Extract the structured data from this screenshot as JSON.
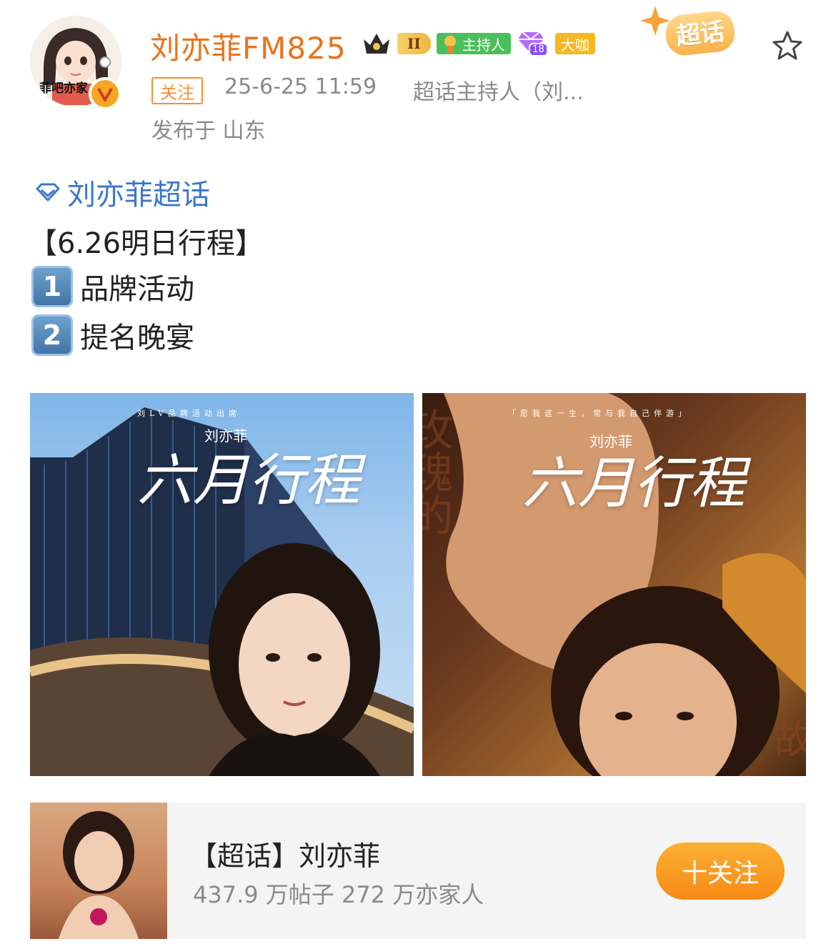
{
  "user": {
    "avatar_text": "菲吧亦家",
    "name": "刘亦菲FM825",
    "badges": {
      "level": "II",
      "host": "主持人",
      "gem_level": "18",
      "daka": "大咖"
    },
    "chaohua_sticker": "超话"
  },
  "meta": {
    "follow": "关注",
    "time": "25-6-25 11:59",
    "source": "超话主持人（刘...",
    "location": "发布于 山东"
  },
  "content": {
    "topic": "刘亦菲超话",
    "headline": "【6.26明日行程】",
    "items": [
      {
        "num": "1",
        "text": "品牌活动"
      },
      {
        "num": "2",
        "text": "提名晚宴"
      }
    ]
  },
  "images": [
    {
      "name": "刘亦菲",
      "title": "六月行程",
      "caption": "刘LV品牌活动出席"
    },
    {
      "name": "刘亦菲",
      "title": "六月行程",
      "caption": "「愿我这一生，常与我自己伴游」",
      "side_text": "玫瑰的",
      "corner_text": "故"
    }
  ],
  "topic_card": {
    "title": "【超话】刘亦菲",
    "stats": "437.9 万帖子  272 万亦家人",
    "follow_label": "十关注"
  },
  "colors": {
    "username": "#e7741d",
    "link": "#3b78c9",
    "meta": "#8a8a8a",
    "follow_button": "#f78a17"
  }
}
